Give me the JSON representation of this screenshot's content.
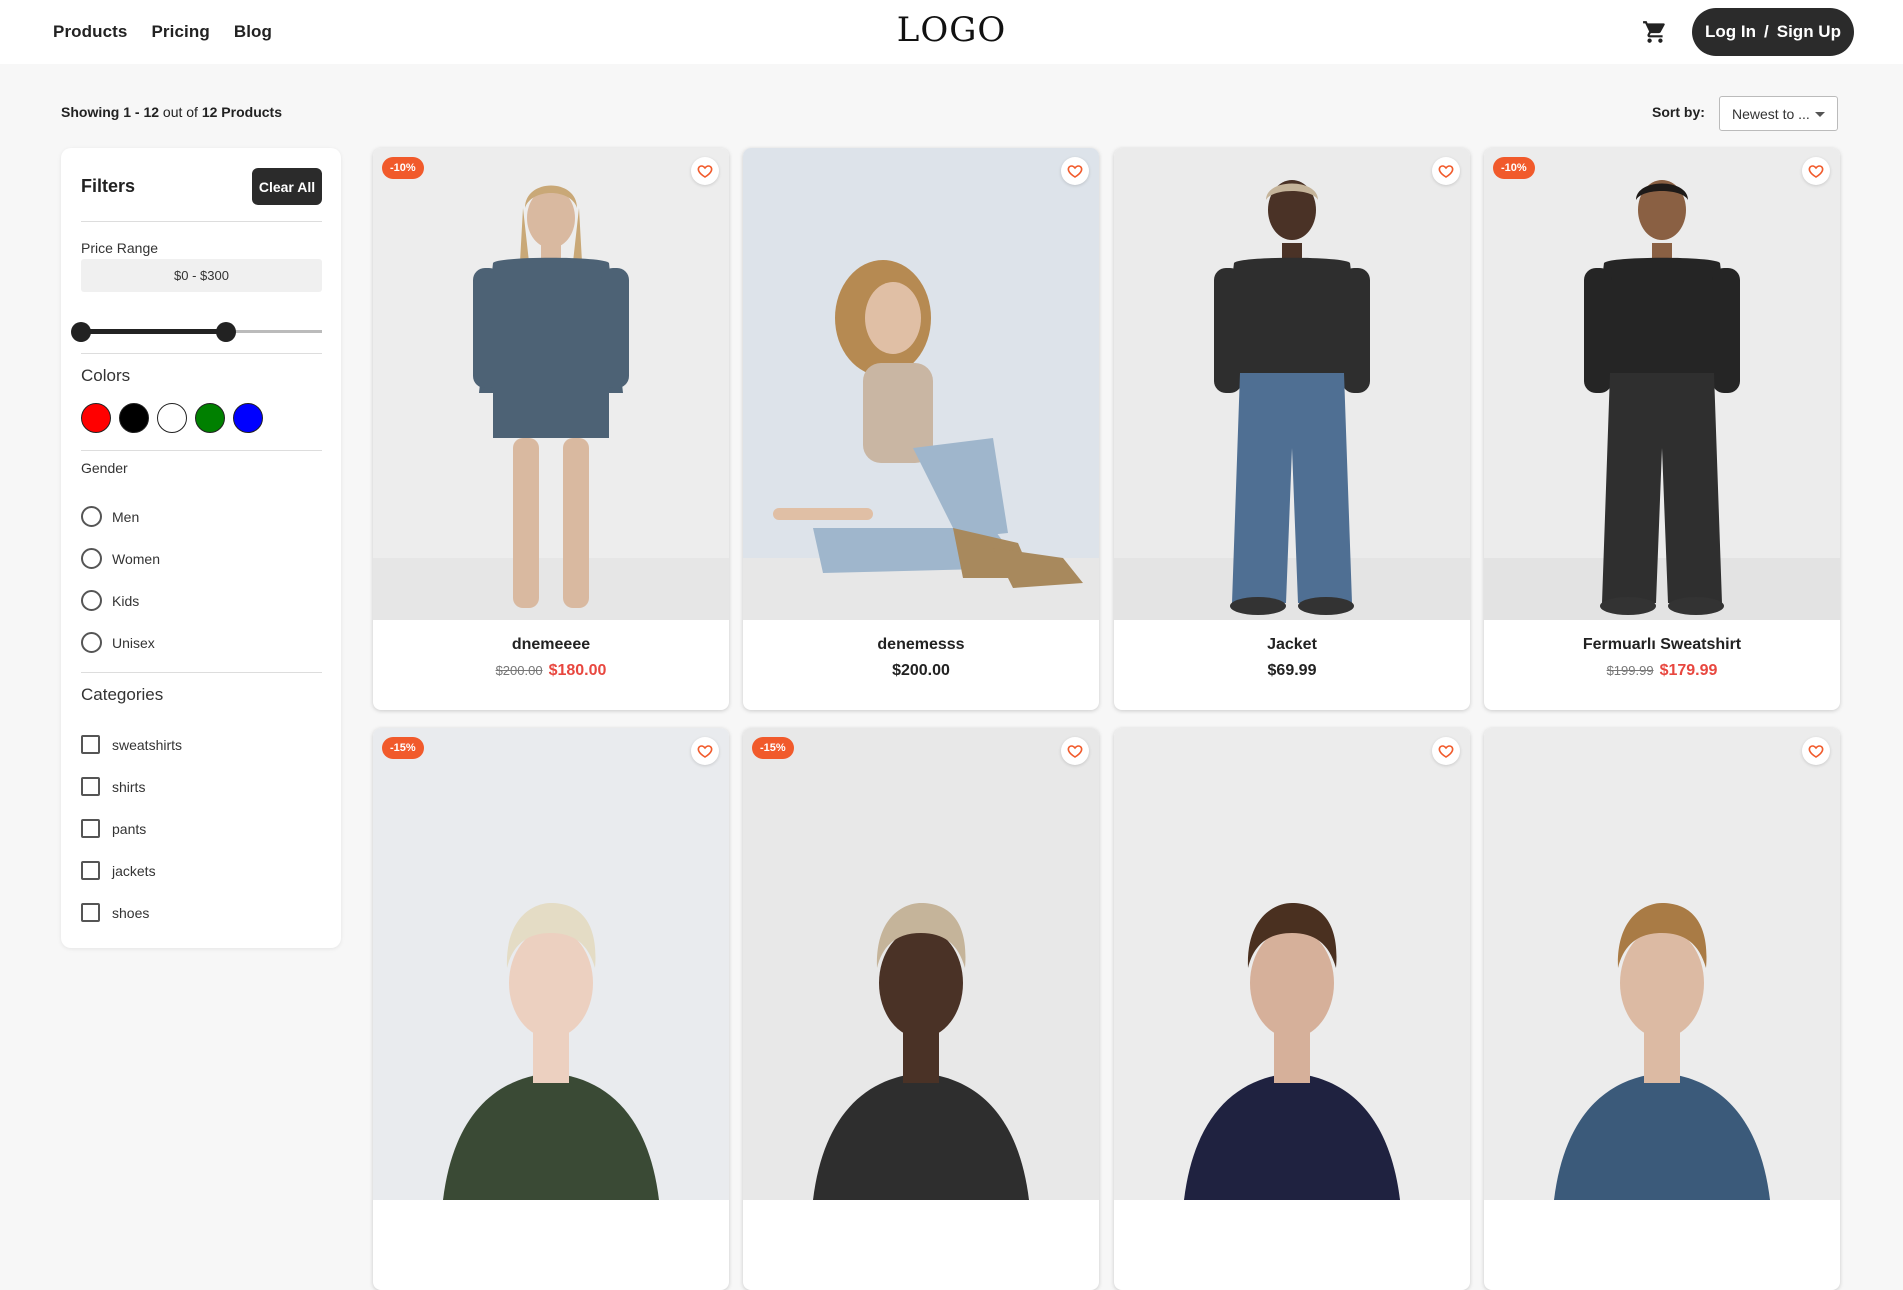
{
  "header": {
    "nav": [
      "Products",
      "Pricing",
      "Blog"
    ],
    "logo": "LOGO",
    "login": "Log In",
    "separator": "/",
    "signup": "Sign Up"
  },
  "toolbar": {
    "showing_prefix": "Showing",
    "range": "1 - 12",
    "out_of": "out of",
    "total": "12 Products",
    "sort_label": "Sort by:",
    "sort_value": "Newest to ..."
  },
  "filters": {
    "title": "Filters",
    "clear_all": "Clear All",
    "price_range_label": "Price Range",
    "price_range_value": "$0 - $300",
    "slider": {
      "min_fraction": 0.0,
      "max_fraction": 0.6
    },
    "colors_title": "Colors",
    "colors": [
      "#ff0000",
      "#000000",
      "#ffffff",
      "#008000",
      "#0000ff"
    ],
    "gender_title": "Gender",
    "genders": [
      "Men",
      "Women",
      "Kids",
      "Unisex"
    ],
    "categories_title": "Categories",
    "categories": [
      "sweatshirts",
      "shirts",
      "pants",
      "jackets",
      "shoes"
    ]
  },
  "products": [
    {
      "name": "dnemeeee",
      "old_price": "$200.00",
      "price": "$180.00",
      "badge": "-10%"
    },
    {
      "name": "denemesss",
      "old_price": "",
      "price": "$200.00",
      "badge": ""
    },
    {
      "name": "Jacket",
      "old_price": "",
      "price": "$69.99",
      "badge": ""
    },
    {
      "name": "Fermuarlı Sweatshirt",
      "old_price": "$199.99",
      "price": "$179.99",
      "badge": "-10%"
    },
    {
      "name": "",
      "old_price": "",
      "price": "",
      "badge": "-15%"
    },
    {
      "name": "",
      "old_price": "",
      "price": "",
      "badge": "-15%"
    },
    {
      "name": "",
      "old_price": "",
      "price": "",
      "badge": ""
    },
    {
      "name": "",
      "old_price": "",
      "price": "",
      "badge": ""
    }
  ],
  "colors": {
    "accent": "#f15a2b",
    "sale_price": "#e8473f",
    "dark": "#2b2b2b"
  }
}
